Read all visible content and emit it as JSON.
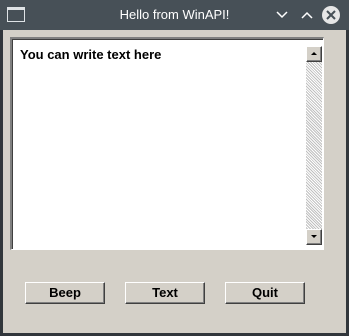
{
  "window": {
    "title": "Hello from WinAPI!"
  },
  "editbox": {
    "text": "You can write text here"
  },
  "buttons": {
    "beep": "Beep",
    "text": "Text",
    "quit": "Quit"
  },
  "icons": {
    "app": "window-icon",
    "minimize": "chevron-down-icon",
    "maximize": "chevron-up-icon",
    "close": "close-icon",
    "scroll_up": "arrow-up-icon",
    "scroll_down": "arrow-down-icon"
  },
  "colors": {
    "titlebar": "#475057",
    "client": "#d4d0c8",
    "close_button": "#e6e6e6"
  }
}
